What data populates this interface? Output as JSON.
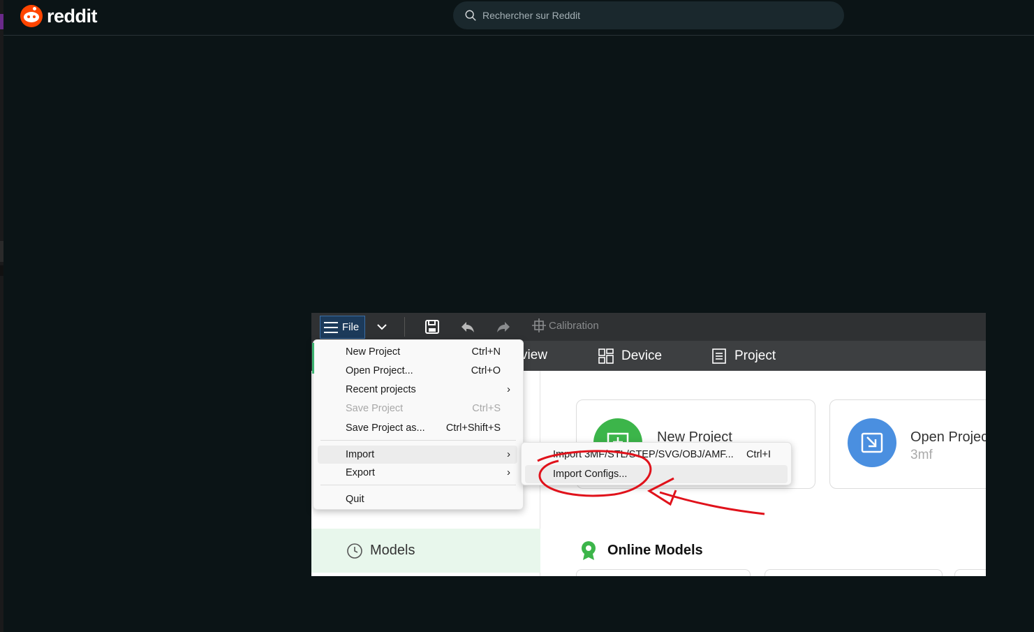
{
  "reddit": {
    "brand": "reddit",
    "search_placeholder": "Rechercher sur Reddit"
  },
  "toolbar": {
    "file_label": "File",
    "calibration_label": "Calibration"
  },
  "tabs": {
    "preview_partial": "view",
    "device": "Device",
    "project": "Project"
  },
  "sidebar": {
    "models_label": "Models"
  },
  "home": {
    "new_project": "New Project",
    "open_project": "Open Projec",
    "open_project_sub": "3mf",
    "online_models": "Online Models"
  },
  "file_menu": {
    "new_project": "New Project",
    "new_project_sc": "Ctrl+N",
    "open_project": "Open Project...",
    "open_project_sc": "Ctrl+O",
    "recent_projects": "Recent projects",
    "save_project": "Save Project",
    "save_project_sc": "Ctrl+S",
    "save_project_as": "Save Project as...",
    "save_project_as_sc": "Ctrl+Shift+S",
    "import": "Import",
    "export": "Export",
    "quit": "Quit"
  },
  "import_menu": {
    "import_files": "Import 3MF/STL/STEP/SVG/OBJ/AMF...",
    "import_files_sc": "Ctrl+I",
    "import_configs": "Import Configs..."
  },
  "colors": {
    "reddit_bg": "#0b1416",
    "reddit_orange": "#ff4500",
    "toolbar_bg": "#2f3133",
    "accent_green": "#00ae42",
    "open_blue": "#4a8fe0",
    "annotation_red": "#e0121b"
  }
}
